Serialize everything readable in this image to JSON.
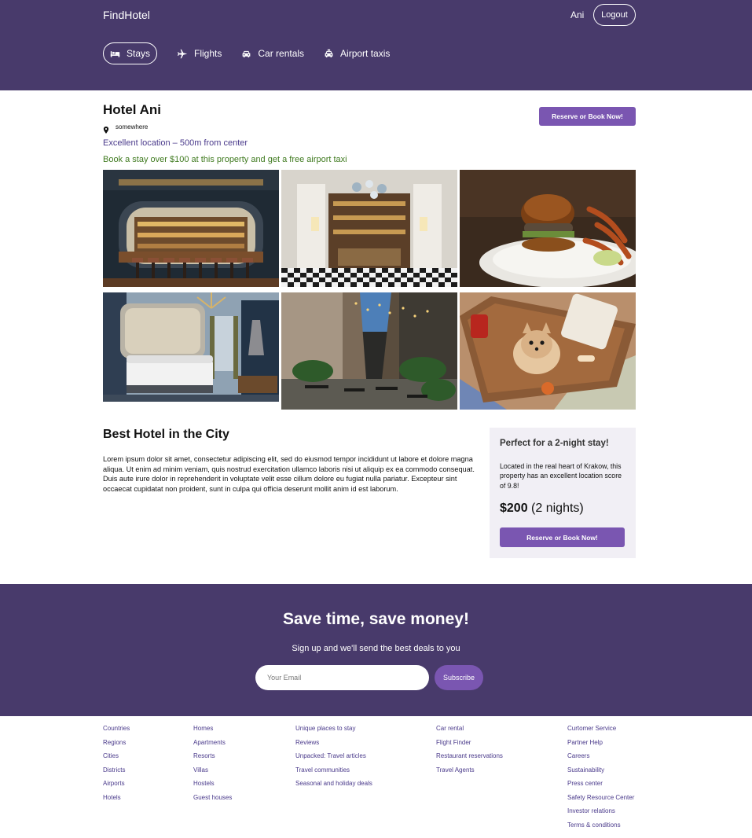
{
  "header": {
    "brand": "FindHotel",
    "user_name": "Ani",
    "logout_label": "Logout",
    "nav": [
      {
        "label": "Stays",
        "icon": "bed-icon",
        "active": true
      },
      {
        "label": "Flights",
        "icon": "plane-icon",
        "active": false
      },
      {
        "label": "Car rentals",
        "icon": "car-icon",
        "active": false
      },
      {
        "label": "Airport taxis",
        "icon": "taxi-icon",
        "active": false
      }
    ]
  },
  "hotel": {
    "name": "Hotel Ani",
    "location": "somewhere",
    "location_note": "Excellent location – 500m from center",
    "promo": "Book a stay over $100 at this property and get a free airport taxi",
    "reserve_label": "Reserve or Book Now!",
    "photos": [
      "bar-photo",
      "lobby-photo",
      "burger-photo",
      "bedroom-photo",
      "courtyard-photo",
      "dog-photo"
    ]
  },
  "details": {
    "title": "Best Hotel in the City",
    "description": "Lorem ipsum dolor sit amet, consectetur adipiscing elit, sed do eiusmod tempor incididunt ut labore et dolore magna aliqua. Ut enim ad minim veniam, quis nostrud exercitation ullamco laboris nisi ut aliquip ex ea commodo consequat. Duis aute irure dolor in reprehenderit in voluptate velit esse cillum dolore eu fugiat nulla pariatur. Excepteur sint occaecat cupidatat non proident, sunt in culpa qui officia deserunt mollit anim id est laborum."
  },
  "booking_card": {
    "title": "Perfect for a 2-night stay!",
    "text": "Located in the real heart of Krakow, this property has an excellent location score of 9.8!",
    "price": "$200",
    "nights": "(2 nights)",
    "reserve_label": "Reserve or Book Now!"
  },
  "newsletter": {
    "title": "Save time, save money!",
    "subtitle": "Sign up and we'll send the best deals to you",
    "email_placeholder": "Your Email",
    "subscribe_label": "Subscribe"
  },
  "footer": {
    "columns": [
      [
        "Countries",
        "Regions",
        "Cities",
        "Districts",
        "Airports",
        "Hotels"
      ],
      [
        "Homes",
        "Apartments",
        "Resorts",
        "Villas",
        "Hostels",
        "Guest houses"
      ],
      [
        "Unique places to stay",
        "Reviews",
        "Unpacked: Travel articles",
        "Travel communities",
        "Seasonal and holiday deals"
      ],
      [
        "Car rental",
        "Flight Finder",
        "Restaurant reservations",
        "Travel Agents"
      ],
      [
        "Curtomer Service",
        "Partner Help",
        "Careers",
        "Sustainability",
        "Press center",
        "Safety Resource Center",
        "Investor relations",
        "Terms & conditions"
      ]
    ]
  },
  "colors": {
    "header_bg": "#483a6b",
    "accent": "#7a56b1",
    "link": "#4a3a8b",
    "promo_green": "#3f7a1f",
    "card_bg": "#f1eff5"
  }
}
